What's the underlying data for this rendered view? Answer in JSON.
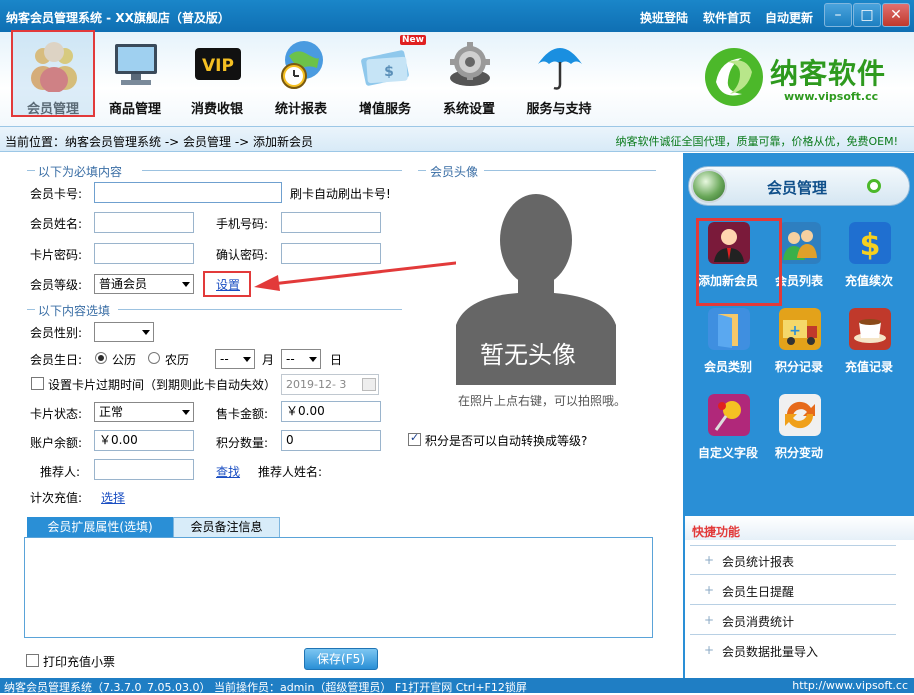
{
  "window": {
    "title": "纳客会员管理系统 - XX旗舰店（普及版）",
    "links": [
      "换班登陆",
      "软件首页",
      "自动更新"
    ],
    "controls": [
      "–",
      "□",
      "✕"
    ]
  },
  "toolbar": {
    "items": [
      {
        "label": "会员管理",
        "icon": "members-icon"
      },
      {
        "label": "商品管理",
        "icon": "monitor-icon"
      },
      {
        "label": "消费收银",
        "icon": "vip-icon"
      },
      {
        "label": "统计报表",
        "icon": "globe-clock-icon"
      },
      {
        "label": "增值服务",
        "icon": "card-icon",
        "badge": "New"
      },
      {
        "label": "系统设置",
        "icon": "gear-icon"
      },
      {
        "label": "服务与支持",
        "icon": "umbrella-icon"
      }
    ],
    "selected": 0
  },
  "brand": {
    "name": "纳客软件",
    "url": "www.vipsoft.cc"
  },
  "breadcrumb": {
    "text": "当前位置：纳客会员管理系统 -> 会员管理 -> 添加新会员",
    "promo": "纳客软件诚征全国代理，质量可靠，价格从优，免费OEM!"
  },
  "form": {
    "required_section": "以下为必填内容",
    "avatar_section": "会员头像",
    "optional_section": "以下内容选填",
    "card_no_label": "会员卡号:",
    "card_hint": "刷卡自动刷出卡号!",
    "name_label": "会员姓名:",
    "phone_label": "手机号码:",
    "pwd_label": "卡片密码:",
    "confirm_label": "确认密码:",
    "level_label": "会员等级:",
    "level_value": "普通会员",
    "level_setting": "设置",
    "gender_label": "会员性别:",
    "birthday_label": "会员生日:",
    "solar": "公历",
    "lunar": "农历",
    "month_sel": "--",
    "day_sel": "--",
    "month_unit": "月",
    "day_unit": "日",
    "expire_label": "设置卡片过期时间（到期则此卡自动失效）",
    "expire_date": "2019-12- 3",
    "status_label": "卡片状态:",
    "status_value": "正常",
    "sale_label": "售卡金额:",
    "sale_value": "￥0.00",
    "balance_label": "账户余额:",
    "balance_value": "￥0.00",
    "points_label": "积分数量:",
    "points_value": "0",
    "auto_level": "积分是否可以自动转换成等级?",
    "referrer_label": "推荐人:",
    "find_link": "查找",
    "referrer_name_label": "推荐人姓名:",
    "count_recharge_label": "计次充值:",
    "select_link": "选择",
    "avatar_placeholder": "暂无头像",
    "avatar_hint": "在照片上点右键，可以拍照哦。",
    "tabs": [
      "会员扩展属性(选填)",
      "会员备注信息"
    ],
    "print_receipt": "打印充值小票",
    "save_button": "保存(F5)"
  },
  "sidebar": {
    "title": "会员管理",
    "items": [
      {
        "label": "添加新会员",
        "icon": "person-suit-icon",
        "color": "#7a1a3a"
      },
      {
        "label": "会员列表",
        "icon": "people-icon",
        "color": "#2e7fc0"
      },
      {
        "label": "充值续次",
        "icon": "dollar-icon",
        "color": "#1f6fd0"
      },
      {
        "label": "会员类别",
        "icon": "door-icon",
        "color": "#3f8fe0"
      },
      {
        "label": "积分记录",
        "icon": "truck-icon",
        "color": "#e3a21a"
      },
      {
        "label": "充值记录",
        "icon": "coffee-icon",
        "color": "#c0392b"
      },
      {
        "label": "自定义字段",
        "icon": "pin-icon",
        "color": "#b0287a"
      },
      {
        "label": "积分变动",
        "icon": "refresh-icon",
        "color": "#e66a1a"
      }
    ],
    "quick_title": "快捷功能",
    "quick_items": [
      "会员统计报表",
      "会员生日提醒",
      "会员消费统计",
      "会员数据批量导入"
    ]
  },
  "statusbar": {
    "left": "纳客会员管理系统（7.3.7.0_7.05.03.0）  当前操作员：admin（超级管理员）  F1打开官网 Ctrl+F12锁屏",
    "right": "http://www.vipsoft.cc"
  },
  "colors": {
    "accent": "#2a8fd6",
    "highlight": "#e23a3a",
    "link": "#1a4ec2"
  }
}
